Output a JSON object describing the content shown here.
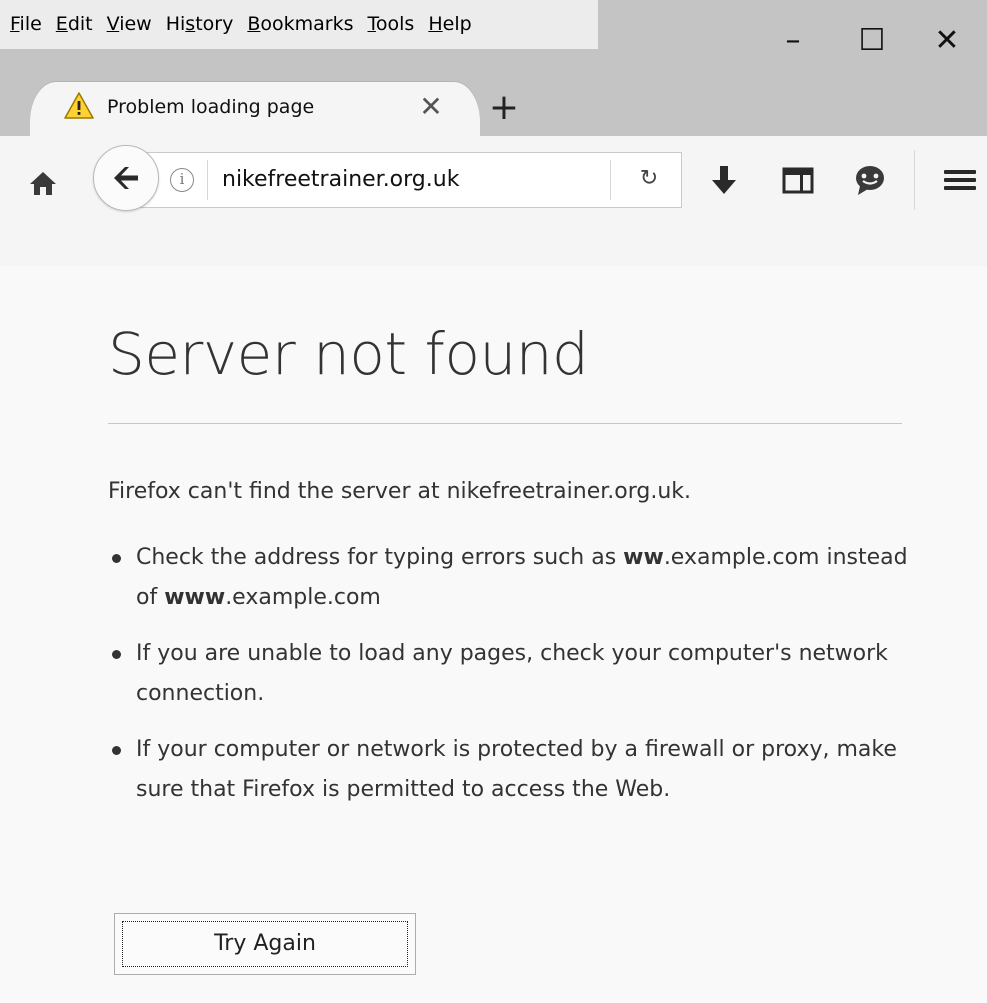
{
  "menubar": {
    "items": [
      {
        "accel": "F",
        "rest": "ile"
      },
      {
        "accel": "E",
        "rest": "dit"
      },
      {
        "accel": "V",
        "rest": "iew"
      },
      {
        "pre": "Hi",
        "accel": "s",
        "rest": "tory"
      },
      {
        "accel": "B",
        "rest": "ookmarks"
      },
      {
        "accel": "T",
        "rest": "ools"
      },
      {
        "accel": "H",
        "rest": "elp"
      }
    ]
  },
  "window_controls": {
    "minimize": "–",
    "maximize": "☐",
    "close": "✕"
  },
  "tab": {
    "title": "Problem loading page",
    "icon": "warning-icon",
    "close": "✕",
    "new_tab": "+"
  },
  "toolbar": {
    "url": "nikefreetrainer.org.uk",
    "info": "i",
    "reload": "↻",
    "icons": [
      "home-icon",
      "back-arrow-icon",
      "download-icon",
      "library-icon",
      "chat-icon",
      "hamburger-menu-icon"
    ]
  },
  "error_page": {
    "title": "Server not found",
    "intro": "Firefox can't find the server at nikefreetrainer.org.uk.",
    "suggestions": {
      "typo": {
        "pre": "Check the address for typing errors such as ",
        "bold_wrong": "ww",
        "mid": ".example.com instead of ",
        "bold_right": "www",
        "post": ".example.com"
      },
      "network": "If you are unable to load any pages, check your computer's network connection.",
      "firewall": "If your computer or network is protected by a firewall or proxy, make sure that Firefox is permitted to access the Web."
    },
    "try_again_label": "Try Again"
  },
  "colors": {
    "titlebar": "#c4c4c4",
    "menubar": "#ececec",
    "toolbar": "#f5f5f5",
    "page_background": "#f9f9fa",
    "warning_yellow": "#ffd133"
  }
}
